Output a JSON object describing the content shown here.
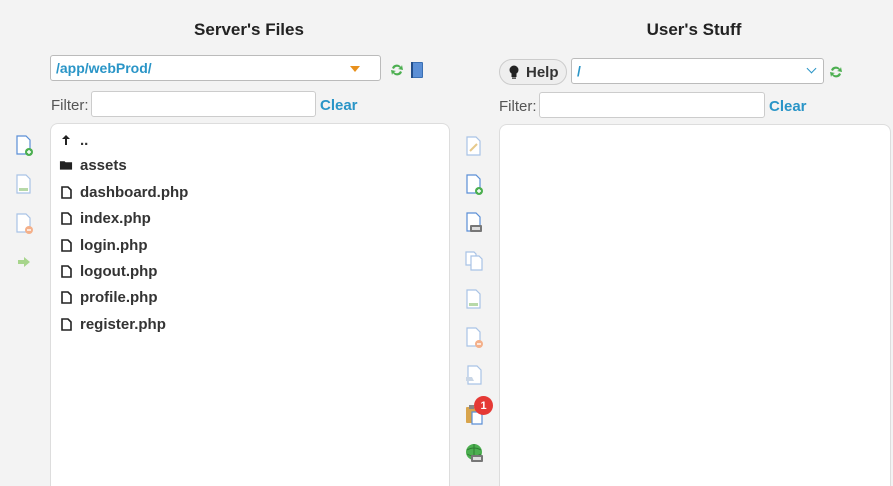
{
  "left": {
    "title": "Server's Files",
    "path": "/app/webProd/",
    "filter_label": "Filter:",
    "filter_value": "",
    "clear_label": "Clear",
    "files": [
      {
        "name": "..",
        "icon": "up-arrow-icon"
      },
      {
        "name": "assets",
        "icon": "folder-icon"
      },
      {
        "name": "dashboard.php",
        "icon": "file-icon"
      },
      {
        "name": "index.php",
        "icon": "file-icon"
      },
      {
        "name": "login.php",
        "icon": "file-icon"
      },
      {
        "name": "logout.php",
        "icon": "file-icon"
      },
      {
        "name": "profile.php",
        "icon": "file-icon"
      },
      {
        "name": "register.php",
        "icon": "file-icon"
      }
    ]
  },
  "right": {
    "title": "User's Stuff",
    "help_label": "Help",
    "path": "/",
    "filter_label": "Filter:",
    "filter_value": "",
    "clear_label": "Clear"
  },
  "clipboard_count": "1",
  "colors": {
    "accent": "#2a95c7",
    "orange": "#e8901c",
    "badge": "#e53935",
    "refresh": "#4caf50"
  }
}
